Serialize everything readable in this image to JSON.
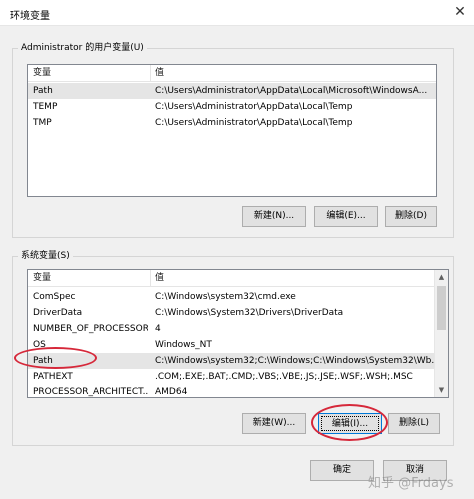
{
  "window": {
    "title": "环境变量",
    "close_glyph": "✕"
  },
  "user_vars": {
    "group_label": "Administrator 的用户变量(U)",
    "columns": {
      "var": "变量",
      "val": "值"
    },
    "rows": [
      {
        "var": "Path",
        "val": "C:\\Users\\Administrator\\AppData\\Local\\Microsoft\\WindowsA..."
      },
      {
        "var": "TEMP",
        "val": "C:\\Users\\Administrator\\AppData\\Local\\Temp"
      },
      {
        "var": "TMP",
        "val": "C:\\Users\\Administrator\\AppData\\Local\\Temp"
      }
    ],
    "buttons": {
      "new": "新建(N)...",
      "edit": "编辑(E)...",
      "delete": "删除(D)"
    }
  },
  "system_vars": {
    "group_label": "系统变量(S)",
    "columns": {
      "var": "变量",
      "val": "值"
    },
    "rows": [
      {
        "var": "ComSpec",
        "val": "C:\\Windows\\system32\\cmd.exe"
      },
      {
        "var": "DriverData",
        "val": "C:\\Windows\\System32\\Drivers\\DriverData"
      },
      {
        "var": "NUMBER_OF_PROCESSORS",
        "val": "4"
      },
      {
        "var": "OS",
        "val": "Windows_NT"
      },
      {
        "var": "Path",
        "val": "C:\\Windows\\system32;C:\\Windows;C:\\Windows\\System32\\Wb..."
      },
      {
        "var": "PATHEXT",
        "val": ".COM;.EXE;.BAT;.CMD;.VBS;.VBE;.JS;.JSE;.WSF;.WSH;.MSC"
      },
      {
        "var": "PROCESSOR_ARCHITECT...",
        "val": "AMD64"
      }
    ],
    "selected_index": 4,
    "buttons": {
      "new": "新建(W)...",
      "edit": "编辑(I)...",
      "delete": "删除(L)"
    }
  },
  "footer": {
    "ok": "确定",
    "cancel": "取消"
  },
  "watermark": "知乎 @Frdays",
  "colors": {
    "annotation": "#d6283a",
    "focus": "#0078d7",
    "selection": "#e5e5e5"
  }
}
